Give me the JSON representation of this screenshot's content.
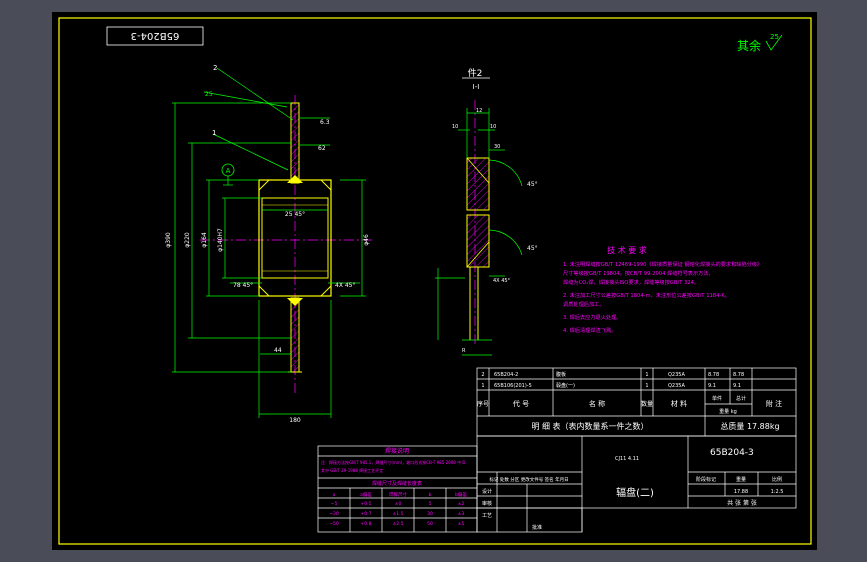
{
  "drawing_code_stamp": "65B204-3",
  "surface_finish_note": "其余",
  "surface_finish_symbol": "25",
  "section_label": "件2",
  "section_sublabel": "I-I",
  "balloons": [
    "1",
    "2"
  ],
  "datum_label": "A",
  "dimensions": {
    "d_outer": "φ390",
    "d_mid": "φ220",
    "d_bore": "φ164",
    "d_hub_inner": "φ140H7",
    "d_hub_outer": "φ46",
    "overall_length": "180",
    "hub_width": "62",
    "flange_offset": "44",
    "chamfer_top": "25 45°",
    "chamfer_left": "78 45°",
    "chamfer_right": "4X 45°",
    "roughness_a": "6.3",
    "roughness_b": "25",
    "section_dims": [
      "12",
      "10",
      "30",
      "10",
      "45°",
      "45°",
      "4X 45°",
      "R"
    ]
  },
  "technical_requirements": {
    "title": "技 术 要 求",
    "lines": [
      "1. 未注明焊缝按GB/T 12469-1990《焊接质量保证 钢熔化焊接头的要求和缺陷分级》",
      "   尺寸等级按GB/T 19804，按CB/T 99-2004 焊缝符号表示方法，",
      "   焊缝为CO₂焊，焊接接头ISO要求，焊缝等级按GB/T 324。",
      "2. 未注加工尺寸公差按GB/T 1804-m，未注形位公差按GB/T 1184-K。",
      "   调质处理后加工。",
      "3. 焊后去应力退火处理。",
      "4. 焊后清理焊渣飞溅。"
    ]
  },
  "parts_list": {
    "rows": [
      {
        "no": "2",
        "code": "65B204-2",
        "name": "腹板",
        "qty": "1",
        "material": "Q235A",
        "unit_weight": "8.78",
        "total_weight": "8.78",
        "note": ""
      },
      {
        "no": "1",
        "code": "65B106(201)-5",
        "name": "毂盘(一)",
        "qty": "1",
        "material": "Q235A",
        "unit_weight": "9.1",
        "total_weight": "9.1",
        "note": ""
      }
    ],
    "header": {
      "no": "序号",
      "code": "代 号",
      "name": "名 称",
      "qty": "数量",
      "material": "材 料",
      "unit": "单件",
      "total": "总计",
      "weight": "重量 kg",
      "note": "附 注"
    },
    "footer_title": "明 细 表（表内数量系一件之数）",
    "total_weight_label": "总质量 17.88kg"
  },
  "title_block": {
    "drawing_no": "65B204-3",
    "part_name": "辐盘(二)",
    "scale_label": "比例",
    "scale_value": "1:2.5",
    "weight_label": "重量",
    "weight_value": "17.88",
    "mark_label": "阶段标记",
    "sheet_label": "共 张 第 张",
    "small_caption": "CJ11 4.11",
    "rows": [
      "标记",
      "处数",
      "分区",
      "更改文件号",
      "签名",
      "年月日"
    ],
    "roles": [
      "设计",
      "审核",
      "工艺",
      "批准"
    ]
  },
  "change_table": {
    "title": "焊接说明",
    "note_lines": [
      "注：焊接方法按GB/T 985.1，焊缝尺寸(mm)，坡口形式按CB-T 985-2008 中 D",
      "其中 GB/T 29-1988 焊接工艺评定"
    ],
    "subtitle": "焊缝尺寸及焊缝长度表",
    "headers": [
      "a",
      "a偏差",
      "焊脚尺寸",
      "b",
      "b偏差"
    ],
    "rows": [
      [
        "~5",
        "+0.5",
        "±0",
        "5",
        "±2"
      ],
      [
        "~30",
        "+0.7",
        "±1.5",
        "30",
        "±3"
      ],
      [
        "~50",
        "+0.8",
        "±2.5",
        "50",
        "±5"
      ],
      [
        "~100",
        "+1.0",
        "±3.5",
        "100",
        "±7"
      ]
    ]
  },
  "colors": {
    "background": "#4a4d57",
    "sheet": "#000000",
    "frame": "#ffff00",
    "geometry": "#ffff00",
    "dimension": "#00ff00",
    "centerline": "#ff00ff",
    "text": "#ffffff",
    "annotation": "#ff00ff",
    "hatch": "#ff00ff"
  }
}
